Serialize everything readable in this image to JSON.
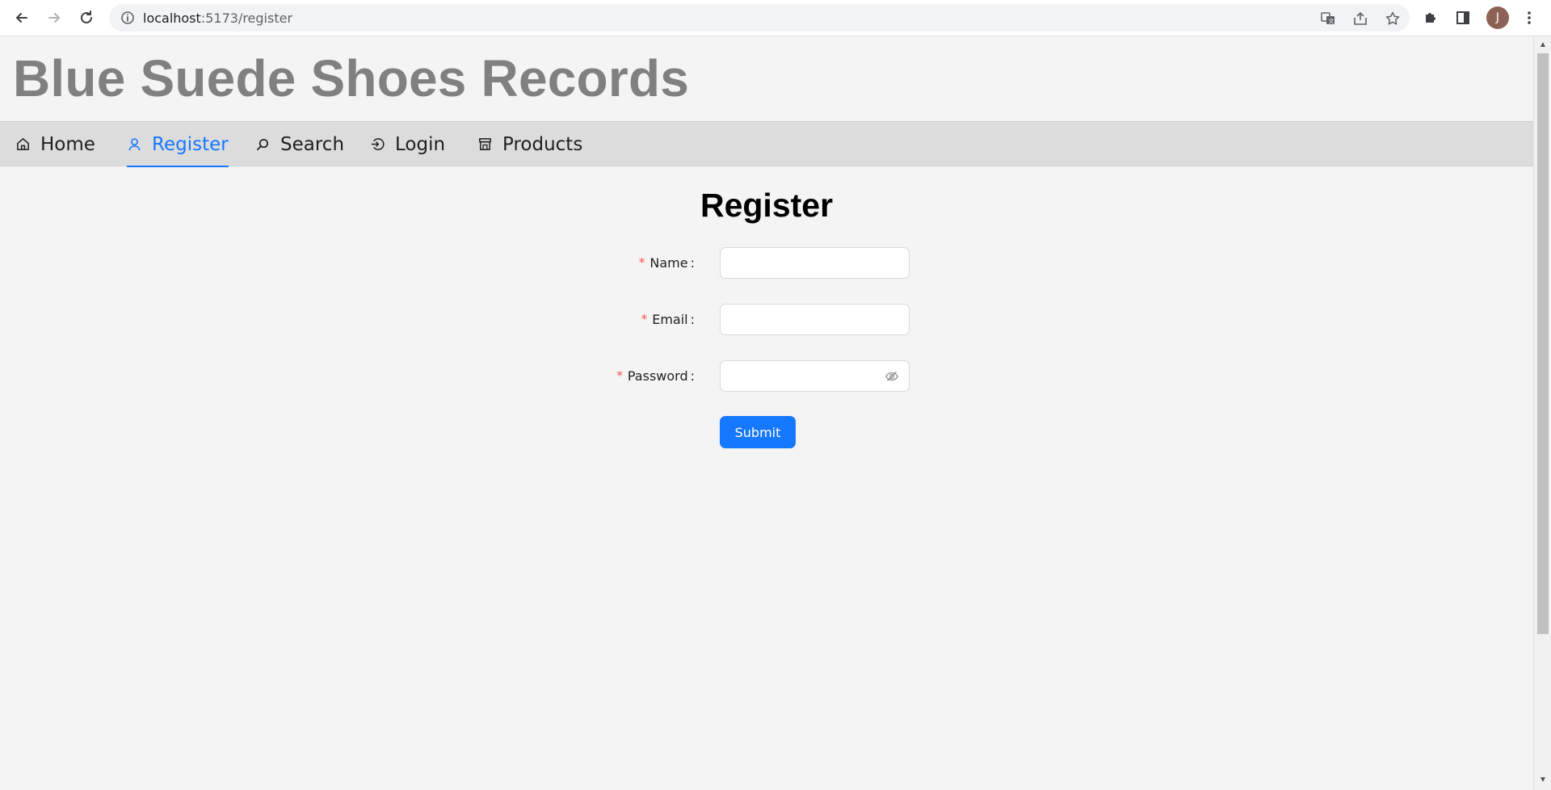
{
  "browser": {
    "url_host": "localhost",
    "url_path": ":5173/register",
    "avatar_initial": "J"
  },
  "site": {
    "title": "Blue Suede Shoes Records"
  },
  "menu": {
    "items": [
      {
        "label": "Home",
        "icon": "home-icon",
        "active": false
      },
      {
        "label": "Register",
        "icon": "user-icon",
        "active": true
      },
      {
        "label": "Search",
        "icon": "search-icon",
        "active": false
      },
      {
        "label": "Login",
        "icon": "login-icon",
        "active": false
      },
      {
        "label": "Products",
        "icon": "shop-icon",
        "active": false
      }
    ]
  },
  "form": {
    "title": "Register",
    "required_mark": "*",
    "fields": [
      {
        "label": "Name",
        "value": ""
      },
      {
        "label": "Email",
        "value": ""
      },
      {
        "label": "Password",
        "value": ""
      }
    ],
    "submit_label": "Submit"
  },
  "colors": {
    "accent": "#1677ff",
    "required": "#ff4d4f",
    "title_gray": "#808080"
  }
}
